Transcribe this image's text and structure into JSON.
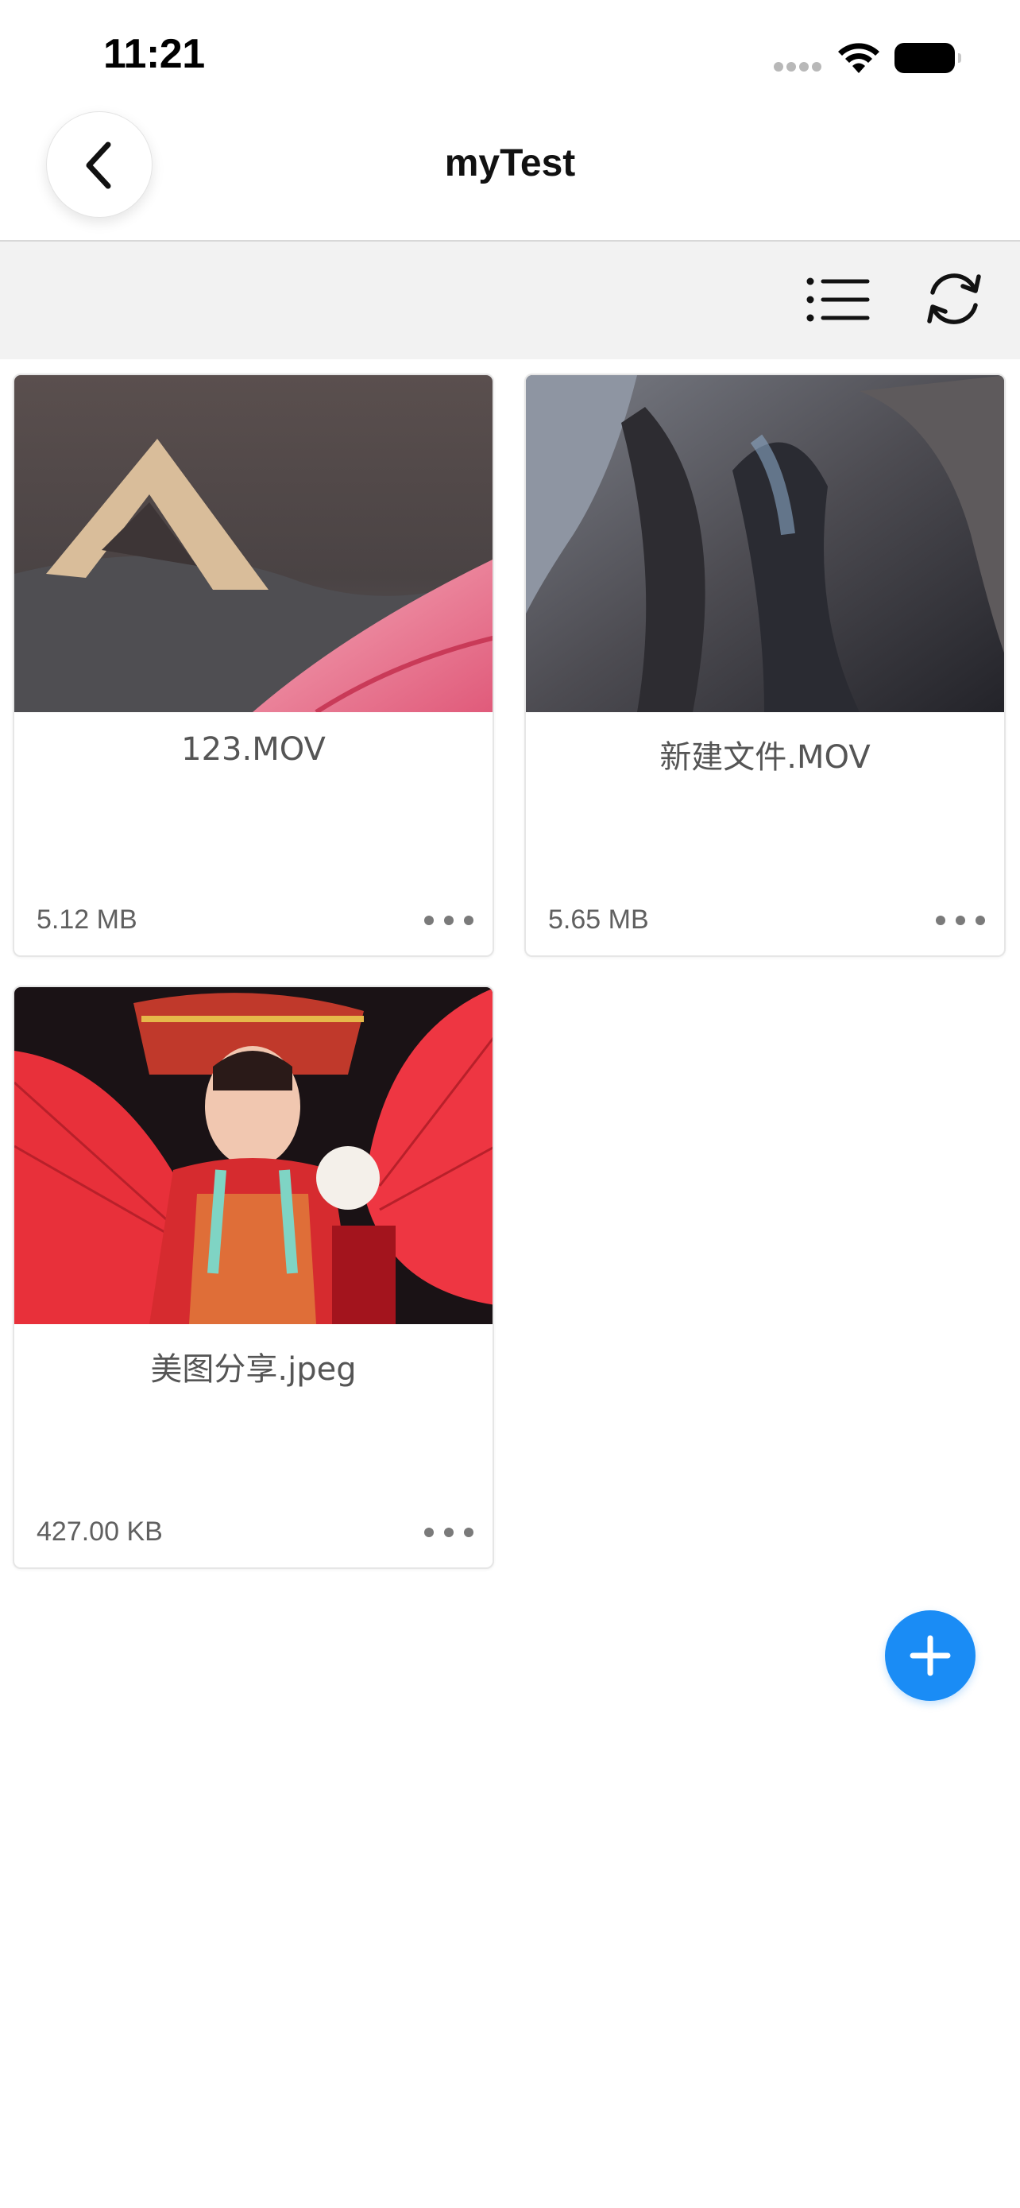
{
  "status_bar": {
    "time": "11:21"
  },
  "nav": {
    "title": "myTest"
  },
  "files": [
    {
      "name": "123.MOV",
      "size": "5.12 MB"
    },
    {
      "name": "新建文件.MOV",
      "size": "5.65 MB"
    },
    {
      "name": "美图分享.jpeg",
      "size": "427.00 KB"
    }
  ],
  "colors": {
    "accent": "#1a8cf5",
    "toolbar_bg": "#f2f2f2",
    "text_secondary": "#606060"
  },
  "icons": {
    "back": "chevron-left-icon",
    "list_view": "list-icon",
    "refresh": "refresh-icon",
    "more": "more-horizontal-icon",
    "add": "plus-icon"
  }
}
